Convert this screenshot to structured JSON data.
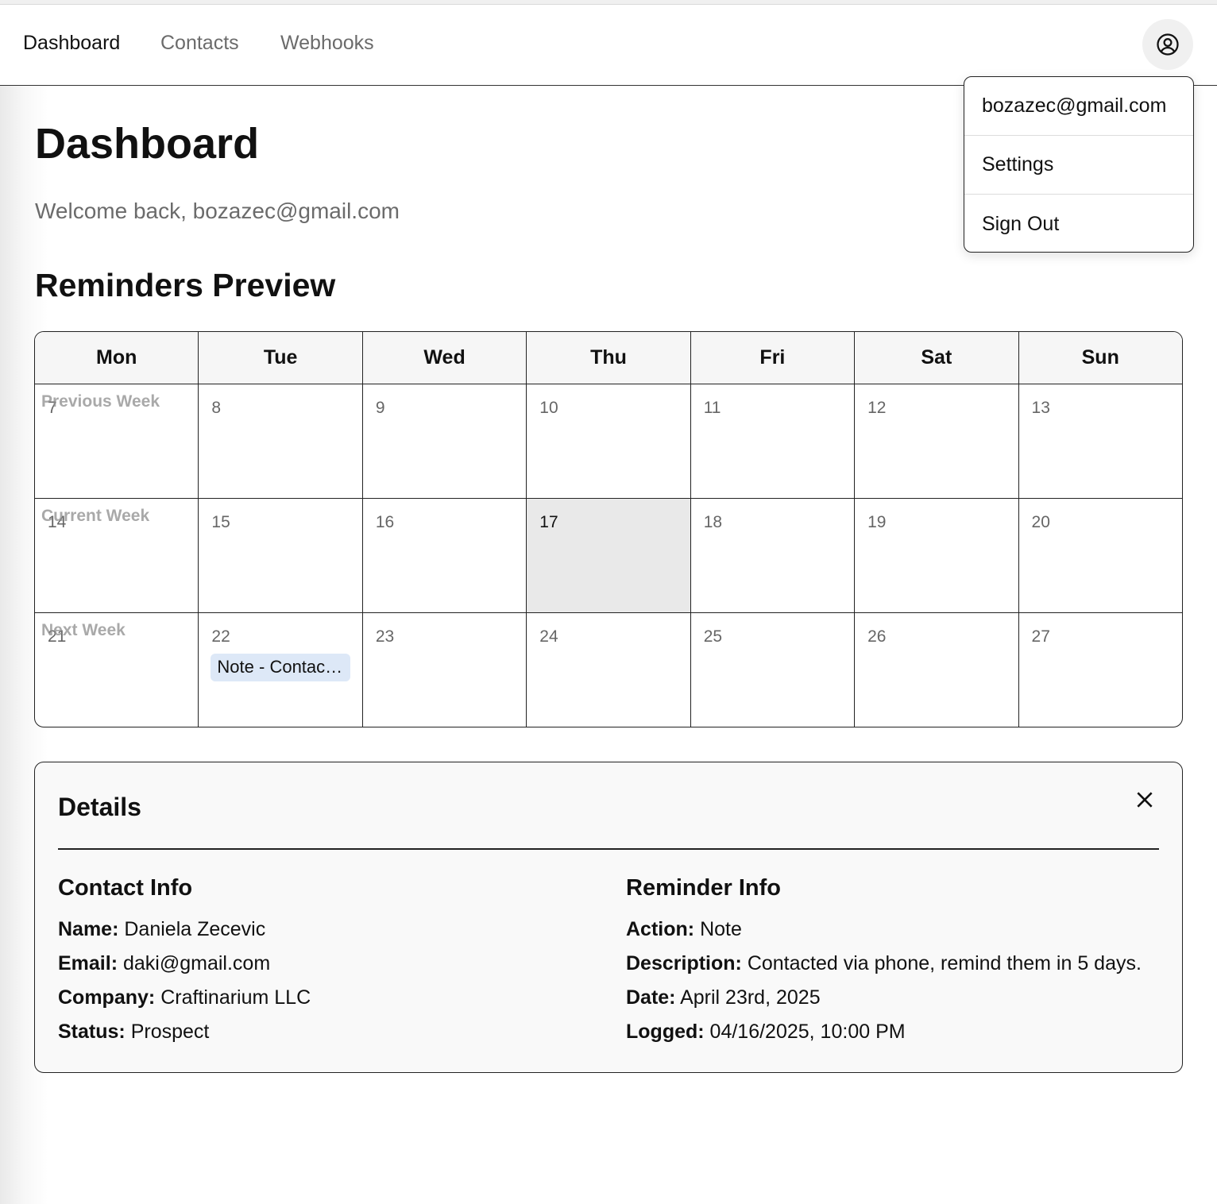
{
  "nav": {
    "items": [
      {
        "label": "Dashboard",
        "active": true
      },
      {
        "label": "Contacts",
        "active": false
      },
      {
        "label": "Webhooks",
        "active": false
      }
    ],
    "avatar_icon": "user-circle-icon"
  },
  "user_menu": {
    "email": "bozazec@gmail.com",
    "settings": "Settings",
    "sign_out": "Sign Out"
  },
  "page": {
    "title": "Dashboard",
    "welcome": "Welcome back, bozazec@gmail.com"
  },
  "reminders": {
    "title": "Reminders Preview",
    "days": [
      "Mon",
      "Tue",
      "Wed",
      "Thu",
      "Fri",
      "Sat",
      "Sun"
    ],
    "weeks": [
      {
        "label": "Previous Week",
        "dates": [
          "7",
          "8",
          "9",
          "10",
          "11",
          "12",
          "13"
        ]
      },
      {
        "label": "Current Week",
        "dates": [
          "14",
          "15",
          "16",
          "17",
          "18",
          "19",
          "20"
        ]
      },
      {
        "label": "Next Week",
        "dates": [
          "21",
          "22",
          "23",
          "24",
          "25",
          "26",
          "27"
        ]
      }
    ],
    "today": "17",
    "event": {
      "label": "Note - Contac…",
      "date": "22",
      "color": "#dde8f7"
    }
  },
  "details": {
    "title": "Details",
    "close_icon": "close-icon",
    "contact": {
      "heading": "Contact Info",
      "name_label": "Name:",
      "name": "Daniela Zecevic",
      "email_label": "Email:",
      "email": "daki@gmail.com",
      "company_label": "Company:",
      "company": "Craftinarium LLC",
      "status_label": "Status:",
      "status": "Prospect"
    },
    "reminder": {
      "heading": "Reminder Info",
      "action_label": "Action:",
      "action": "Note",
      "description_label": "Description:",
      "description": "Contacted via phone, remind them in 5 days.",
      "date_label": "Date:",
      "date": "April 23rd, 2025",
      "logged_label": "Logged:",
      "logged": "04/16/2025, 10:00 PM"
    }
  }
}
